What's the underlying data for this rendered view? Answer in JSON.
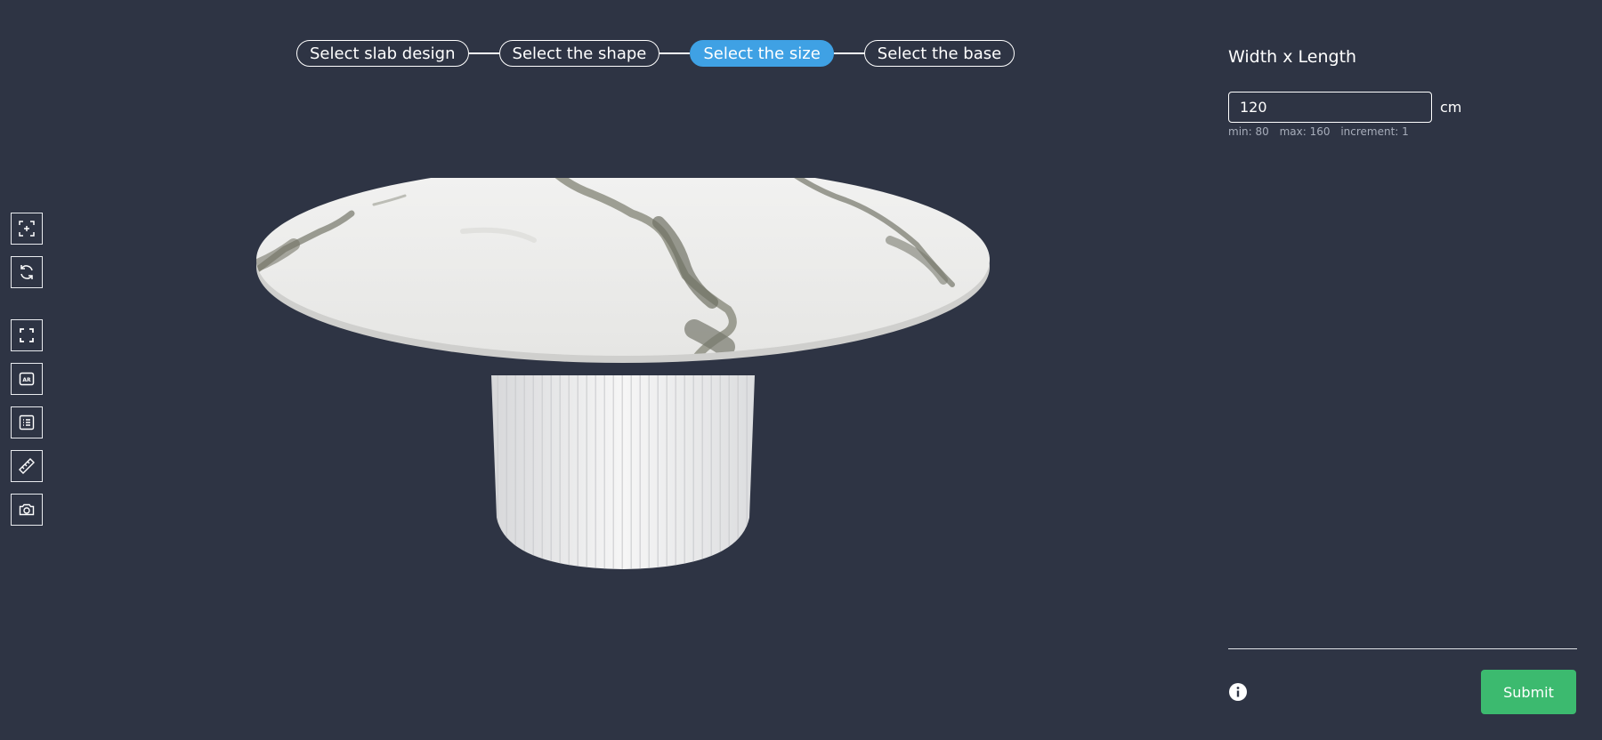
{
  "stepper": {
    "steps": [
      {
        "label": "Select slab design",
        "active": false
      },
      {
        "label": "Select the shape",
        "active": false
      },
      {
        "label": "Select the size",
        "active": true
      },
      {
        "label": "Select the base",
        "active": false
      }
    ]
  },
  "toolbar": {
    "tools": [
      {
        "name": "focus-icon"
      },
      {
        "name": "rotate-icon"
      },
      {
        "name": "fullscreen-icon"
      },
      {
        "name": "ar-icon",
        "text": "AR"
      },
      {
        "name": "list-icon"
      },
      {
        "name": "ruler-icon"
      },
      {
        "name": "camera-icon"
      }
    ]
  },
  "panel": {
    "dimension_label": "Width x Length",
    "width_value": "120",
    "unit": "cm",
    "min_label": "min: 80",
    "max_label": "max: 160",
    "increment_label": "increment: 1",
    "submit_label": "Submit"
  },
  "colors": {
    "background": "#2e3444",
    "accent": "#3fa1e4",
    "submit": "#3cba6f",
    "muted_text": "#a7adba"
  }
}
